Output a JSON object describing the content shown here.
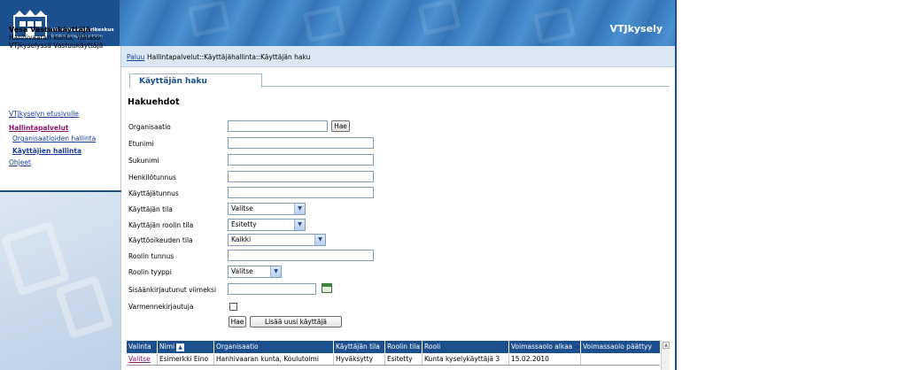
{
  "header": {
    "logo_line1": "Väestörekisterikeskus",
    "logo_line2": "Befolkningsregistercentralen",
    "app_title": "VTJkysely"
  },
  "sidebar": {
    "user_name": "Vesa Vastuukäyttäjä",
    "user_org": "Hanhivaaran kunta, Ylätaso VTJkyselyssä Vastuukäyttäjä",
    "links": {
      "home": "VTJkyselyn etusivulle",
      "admin": "Hallintapalvelut",
      "org_admin": "Organisaatioiden hallinta",
      "user_admin": "Käyttäjien hallinta",
      "help": "Ohjeet"
    }
  },
  "breadcrumb": {
    "back": "Paluu",
    "path": "Hallintapalvelut::Käyttäjähallinta::Käyttäjän haku"
  },
  "tab": {
    "label": "Käyttäjän haku"
  },
  "form": {
    "section_title": "Hakuehdot",
    "labels": {
      "organisaatio": "Organisaatio",
      "etunimi": "Etunimi",
      "sukunimi": "Sukunimi",
      "henkilotunnus": "Henkilötunnus",
      "kayttajatunnus": "Käyttäjätunnus",
      "kayttajan_tila": "Käyttäjän tila",
      "roolin_tila": "Käyttäjän roolin tila",
      "kayttooikeuden_tila": "Käyttöoikeuden tila",
      "roolin_tunnus": "Roolin tunnus",
      "roolin_tyyppi": "Roolin tyyppi",
      "sisaankirjautunut": "Sisäänkirjautunut viimeksi",
      "varmennekirjautuja": "Varmennekirjautuja"
    },
    "values": {
      "kayttajan_tila": "Valitse",
      "roolin_tila": "Esitetty",
      "kayttooikeuden_tila": "Kaikki",
      "roolin_tyyppi": "Valitse"
    },
    "buttons": {
      "hae_org": "Hae",
      "hae": "Hae",
      "add_user": "Lisää uusi käyttäjä"
    }
  },
  "results": {
    "columns": [
      "Valinta",
      "Nimi",
      "Organisaatio",
      "Käyttäjän tila",
      "Roolin tila",
      "Rooli",
      "Voimassaolo alkaa",
      "Voimassaolo päättyy"
    ],
    "rows": [
      {
        "select": "Valitse",
        "name": "Esimerkki Eino",
        "org": "Hanhivaaran kunta, Koulutoimi",
        "user_state": "Hyväksytty",
        "role_state": "Esitetty",
        "role": "Kunta kyselykäyttäjä 3",
        "valid_from": "15.02.2010",
        "valid_to": ""
      }
    ]
  },
  "colors": {
    "header_dark": "#1c4f8e",
    "header_blue": "#3a7fc1",
    "link": "#1a3f9a",
    "active_link": "#8a1a6e"
  }
}
